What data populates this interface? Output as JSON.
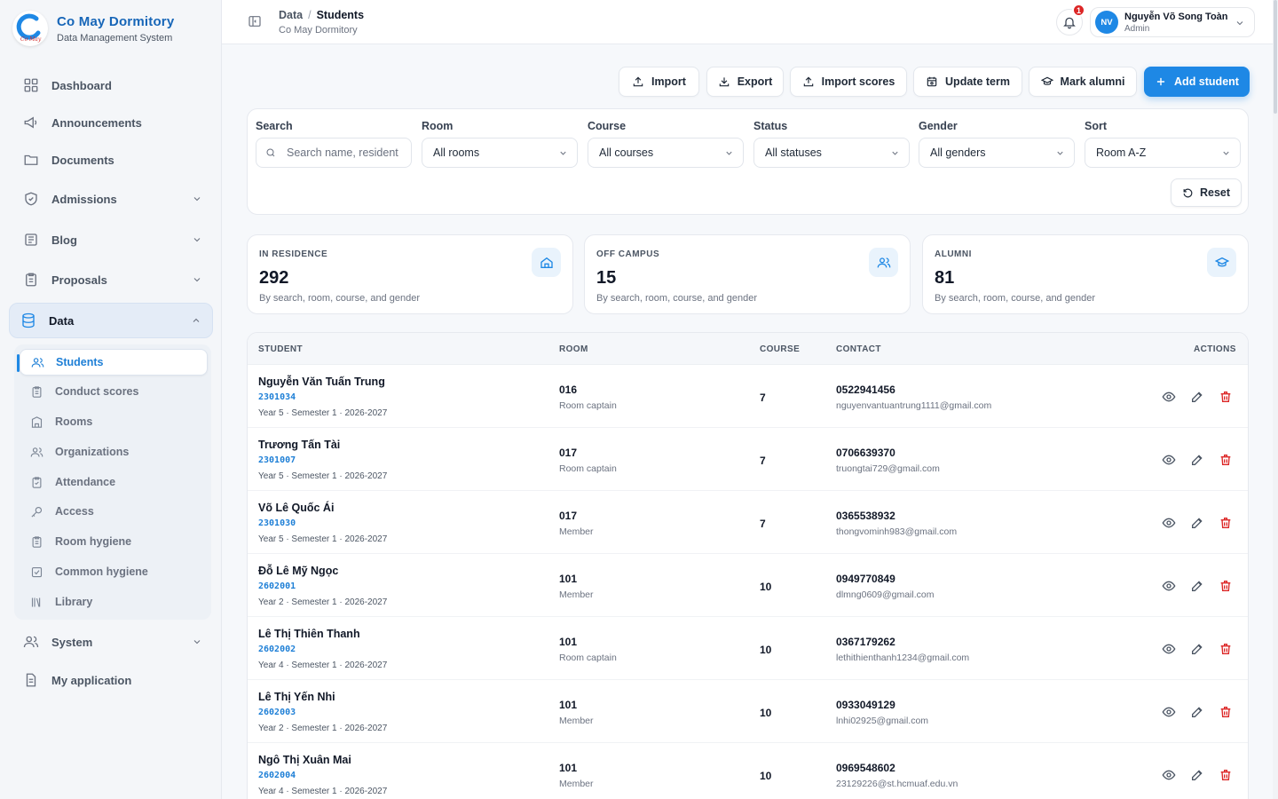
{
  "brand": {
    "title": "Co May Dormitory",
    "subtitle": "Data Management System",
    "logo_text": "Cơ May"
  },
  "sidebar": {
    "items": [
      {
        "label": "Dashboard",
        "icon": "grid-icon"
      },
      {
        "label": "Announcements",
        "icon": "megaphone-icon"
      },
      {
        "label": "Documents",
        "icon": "folder-icon"
      },
      {
        "label": "Admissions",
        "icon": "shield-icon",
        "expandable": true
      },
      {
        "label": "Blog",
        "icon": "newspaper-icon",
        "expandable": true
      },
      {
        "label": "Proposals",
        "icon": "clipboard-icon",
        "expandable": true
      },
      {
        "label": "Data",
        "icon": "database-icon",
        "expanded": true,
        "active": true
      },
      {
        "label": "System",
        "icon": "users-icon",
        "expandable": true
      },
      {
        "label": "My application",
        "icon": "file-text-icon"
      }
    ],
    "data_subitems": [
      {
        "label": "Students",
        "icon": "users-icon",
        "active": true
      },
      {
        "label": "Conduct scores",
        "icon": "clipboard-icon"
      },
      {
        "label": "Rooms",
        "icon": "building-icon"
      },
      {
        "label": "Organizations",
        "icon": "users-icon"
      },
      {
        "label": "Attendance",
        "icon": "clipboard-check-icon"
      },
      {
        "label": "Access",
        "icon": "key-icon"
      },
      {
        "label": "Room hygiene",
        "icon": "clipboard-icon"
      },
      {
        "label": "Common hygiene",
        "icon": "check-square-icon"
      },
      {
        "label": "Library",
        "icon": "library-icon"
      }
    ]
  },
  "header": {
    "breadcrumb_parent": "Data",
    "breadcrumb_sep": "/",
    "breadcrumb_current": "Students",
    "subtitle": "Co May Dormitory",
    "notifications_count": "1",
    "user": {
      "initials": "NV",
      "name": "Nguyễn Võ Song Toàn",
      "role": "Admin"
    }
  },
  "toolbar": {
    "import": "Import",
    "export": "Export",
    "import_scores": "Import scores",
    "update_term": "Update term",
    "mark_alumni": "Mark alumni",
    "add_student": "Add student"
  },
  "filters": {
    "search": {
      "label": "Search",
      "placeholder": "Search name, resident",
      "value": ""
    },
    "room": {
      "label": "Room",
      "value": "All rooms"
    },
    "course": {
      "label": "Course",
      "value": "All courses"
    },
    "status": {
      "label": "Status",
      "value": "All statuses"
    },
    "gender": {
      "label": "Gender",
      "value": "All genders"
    },
    "sort": {
      "label": "Sort",
      "value": "Room A-Z"
    },
    "reset": "Reset"
  },
  "stats": [
    {
      "label": "IN RESIDENCE",
      "value": "292",
      "desc": "By search, room, course, and gender",
      "icon": "home-icon"
    },
    {
      "label": "OFF CAMPUS",
      "value": "15",
      "desc": "By search, room, course, and gender",
      "icon": "users-icon"
    },
    {
      "label": "ALUMNI",
      "value": "81",
      "desc": "By search, room, course, and gender",
      "icon": "graduation-cap-icon"
    }
  ],
  "table": {
    "columns": {
      "student": "STUDENT",
      "room": "ROOM",
      "course": "COURSE",
      "contact": "CONTACT",
      "actions": "ACTIONS"
    },
    "rows": [
      {
        "name": "Nguyễn Văn Tuấn Trung",
        "id": "2301034",
        "meta": "Year 5 · Semester 1 · 2026-2027",
        "room": "016",
        "role": "Room captain",
        "course": "7",
        "phone": "0522941456",
        "email": "nguyenvantuantrung1111@gmail.com"
      },
      {
        "name": "Trương Tấn Tài",
        "id": "2301007",
        "meta": "Year 5 · Semester 1 · 2026-2027",
        "room": "017",
        "role": "Room captain",
        "course": "7",
        "phone": "0706639370",
        "email": "truongtai729@gmail.com"
      },
      {
        "name": "Võ Lê Quốc Ái",
        "id": "2301030",
        "meta": "Year 5 · Semester 1 · 2026-2027",
        "room": "017",
        "role": "Member",
        "course": "7",
        "phone": "0365538932",
        "email": "thongvominh983@gmail.com"
      },
      {
        "name": "Đỗ Lê Mỹ Ngọc",
        "id": "2602001",
        "meta": "Year 2 · Semester 1 · 2026-2027",
        "room": "101",
        "role": "Member",
        "course": "10",
        "phone": "0949770849",
        "email": "dlmng0609@gmail.com"
      },
      {
        "name": "Lê Thị Thiên Thanh",
        "id": "2602002",
        "meta": "Year 4 · Semester 1 · 2026-2027",
        "room": "101",
        "role": "Room captain",
        "course": "10",
        "phone": "0367179262",
        "email": "lethithienthanh1234@gmail.com"
      },
      {
        "name": "Lê Thị Yến Nhi",
        "id": "2602003",
        "meta": "Year 2 · Semester 1 · 2026-2027",
        "room": "101",
        "role": "Member",
        "course": "10",
        "phone": "0933049129",
        "email": "lnhi02925@gmail.com"
      },
      {
        "name": "Ngô Thị Xuân Mai",
        "id": "2602004",
        "meta": "Year 4 · Semester 1 · 2026-2027",
        "room": "101",
        "role": "Member",
        "course": "10",
        "phone": "0969548602",
        "email": "23129226@st.hcmuaf.edu.vn"
      }
    ]
  },
  "colors": {
    "accent": "#1e88e5",
    "danger": "#dc2626",
    "sidebar_bg": "#f4f6f9"
  }
}
